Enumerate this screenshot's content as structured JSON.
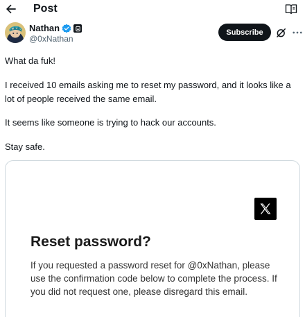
{
  "header": {
    "title": "Post",
    "back_icon": "arrow-left-icon",
    "reader_icon": "book-open-icon"
  },
  "author": {
    "name": "Nathan",
    "handle": "@0xNathan",
    "verified_color": "#1d9bf0",
    "subscribe_label": "Subscribe"
  },
  "tweet": {
    "line1": "What da fuk!",
    "line2": "I received 10 emails asking me to reset my password, and it looks like a lot of people received the same email.",
    "line3": "It seems like someone is trying to hack our accounts.",
    "line4": "Stay safe."
  },
  "media": {
    "email_title": "Reset password?",
    "email_body": "If you requested a password reset for @0xNathan, please use the confirmation code below to complete the process. If you did not request one, please disregard this email."
  },
  "colors": {
    "text": "#0f1419",
    "secondary": "#536471",
    "border": "#cfd9de"
  }
}
